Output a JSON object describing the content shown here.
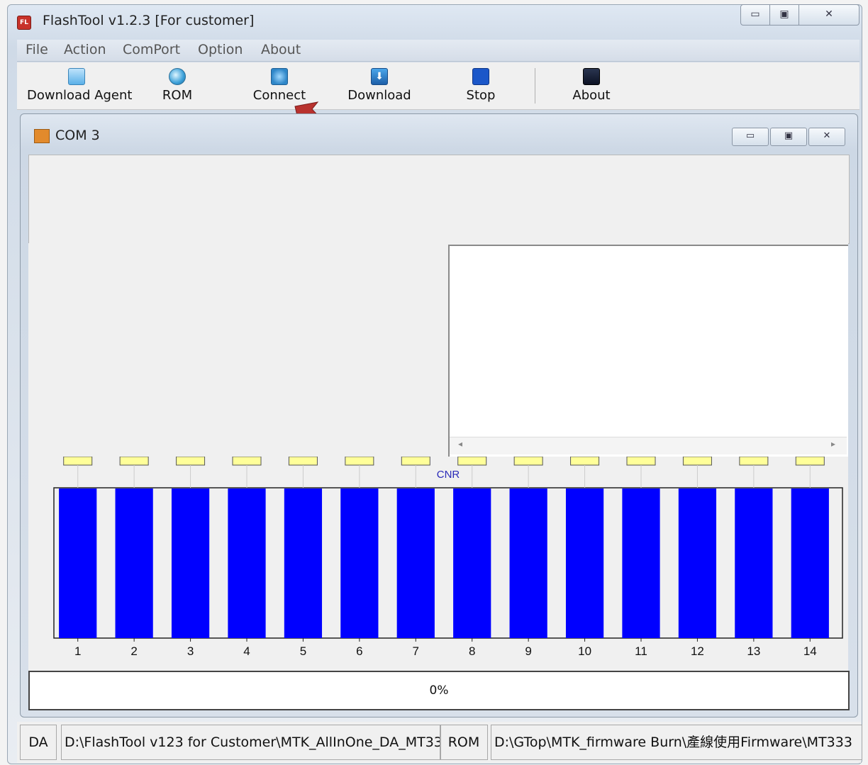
{
  "window": {
    "title": "FlashTool v1.2.3 [For customer]",
    "app_icon_text": "FL"
  },
  "menu": [
    "File",
    "Action",
    "ComPort",
    "Option",
    "About"
  ],
  "toolbar": [
    {
      "label": "Download Agent",
      "icon": "folder-icon"
    },
    {
      "label": "ROM",
      "icon": "globe-icon"
    },
    {
      "label": "Connect",
      "icon": "connect-icon"
    },
    {
      "label": "Download",
      "icon": "download-icon"
    },
    {
      "label": "Stop",
      "icon": "stop-icon"
    },
    {
      "label": "About",
      "icon": "about-icon"
    }
  ],
  "child_window": {
    "title": "COM 3"
  },
  "chart_data": {
    "type": "bar",
    "title": "CNR",
    "categories": [
      "1",
      "2",
      "3",
      "4",
      "5",
      "6",
      "7",
      "8",
      "9",
      "10",
      "11",
      "12",
      "13",
      "14"
    ],
    "values": [
      100,
      100,
      100,
      100,
      100,
      100,
      100,
      100,
      100,
      100,
      100,
      100,
      100,
      100
    ],
    "bar_color": "#0000ff",
    "grid": false
  },
  "progress": {
    "text": "0%",
    "value": 0
  },
  "statusbar": {
    "da_label": "DA",
    "da_path": "D:\\FlashTool v123 for Customer\\MTK_AllInOne_DA_MT33",
    "rom_label": "ROM",
    "rom_path": "D:\\GTop\\MTK_firmware Burn\\產線使用Firmware\\MT333"
  },
  "colors": {
    "accent": "#0000ff",
    "arrow": "#b8322e"
  }
}
